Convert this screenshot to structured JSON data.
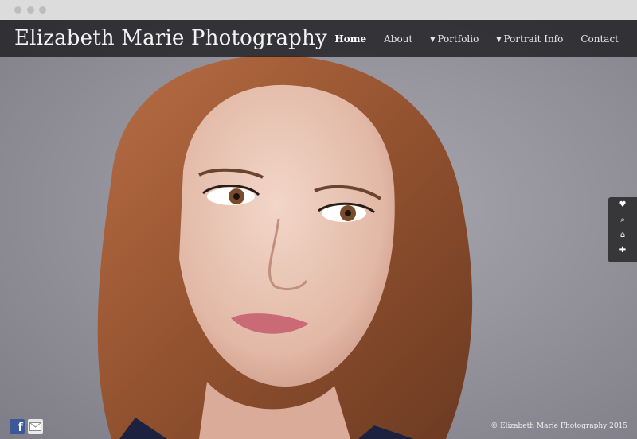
{
  "browser": {
    "controls": [
      "close",
      "minimize",
      "maximize"
    ]
  },
  "site": {
    "title": "Elizabeth Marie Photography"
  },
  "nav": {
    "items": [
      {
        "label": "Home",
        "active": true,
        "dropdown": false
      },
      {
        "label": "About",
        "active": false,
        "dropdown": false
      },
      {
        "label": "Portfolio",
        "active": false,
        "dropdown": true
      },
      {
        "label": "Portrait Info",
        "active": false,
        "dropdown": true
      },
      {
        "label": "Contact",
        "active": false,
        "dropdown": false
      }
    ]
  },
  "tools": {
    "icons": [
      "heart-icon",
      "search-icon",
      "home-icon",
      "plus-icon"
    ],
    "glyphs": [
      "♥",
      "⌕",
      "⌂",
      "✚"
    ]
  },
  "social": {
    "icons": [
      "facebook-icon",
      "email-icon"
    ],
    "facebook_glyph": "f"
  },
  "footer": {
    "copyright": "© Elizabeth Marie Photography 2015"
  },
  "colors": {
    "nav_bg": "#1a1a1c",
    "facebook": "#3b5998"
  }
}
